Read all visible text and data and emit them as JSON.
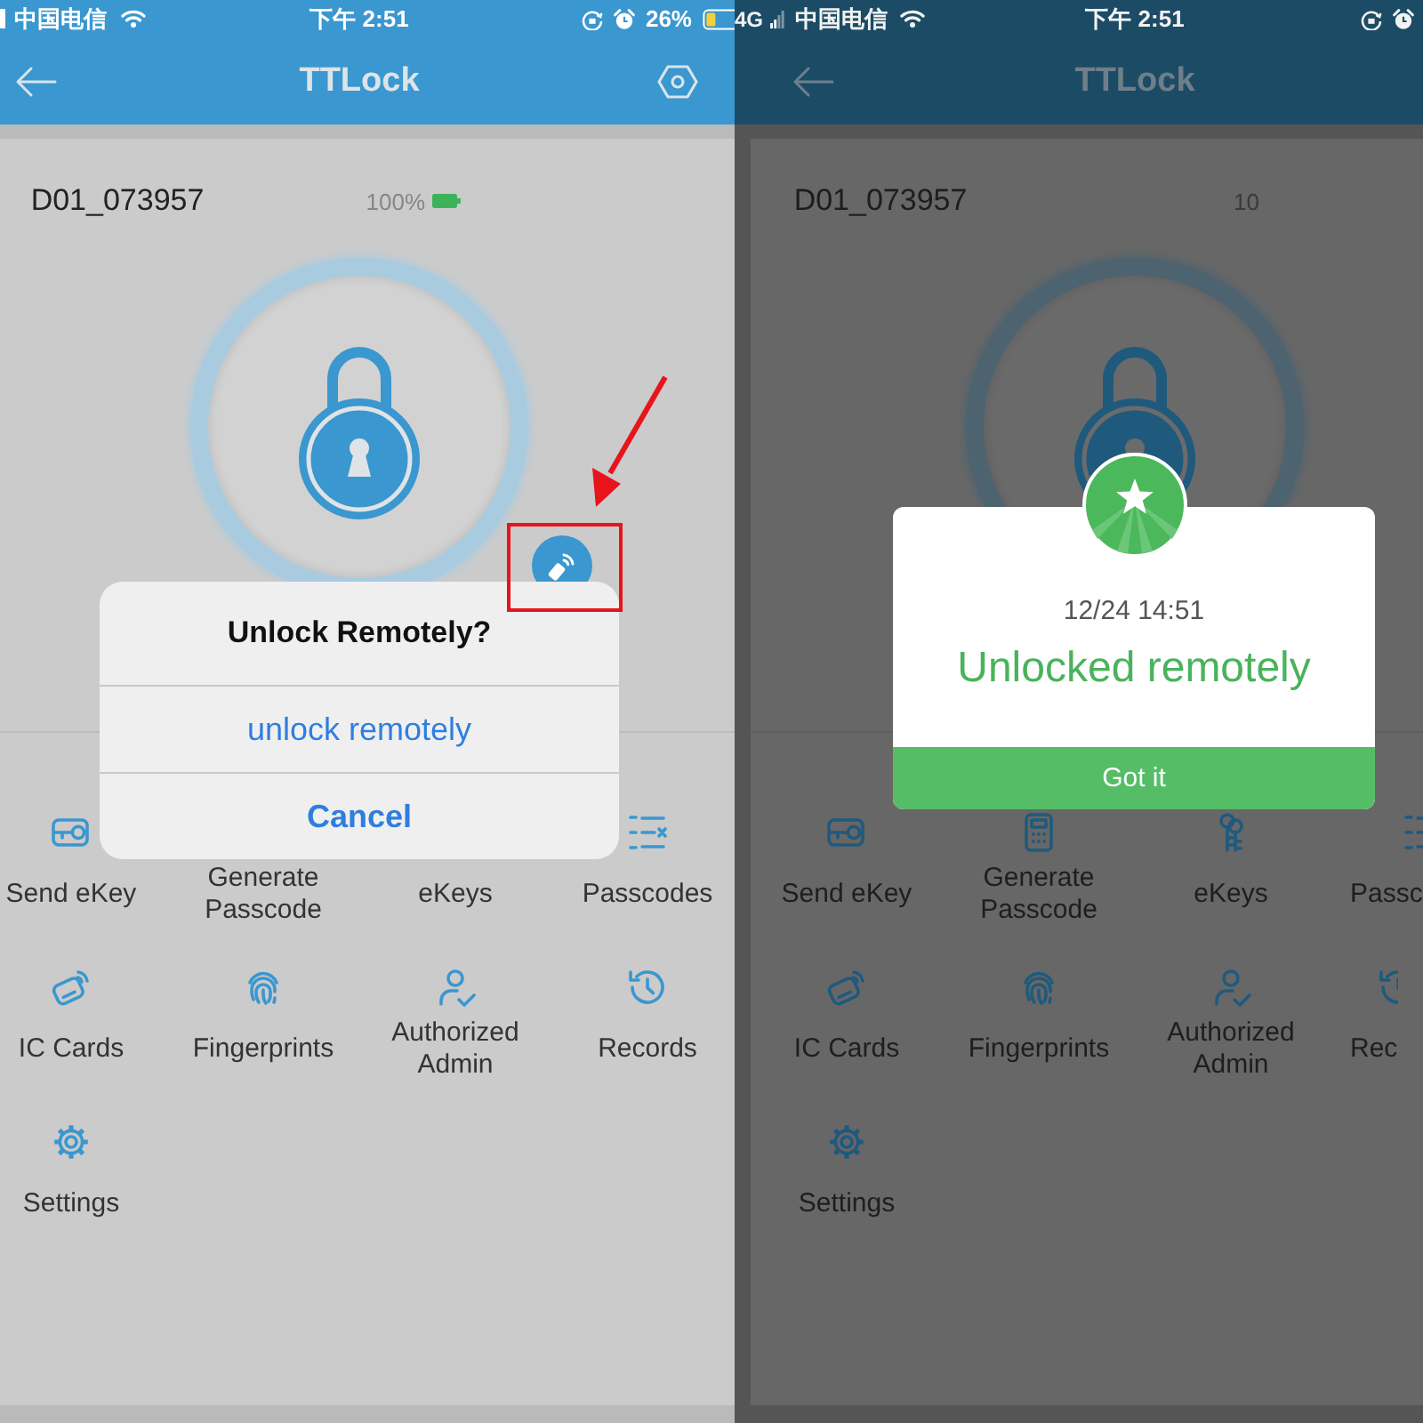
{
  "panels": [
    {
      "kind": "confirm",
      "status_bar": {
        "carrier": "中国电信",
        "time": "下午 2:51",
        "battery": "26%"
      },
      "nav": {
        "title": "TTLock"
      },
      "lock": {
        "name": "D01_073957",
        "battery": "100%"
      },
      "remote_button": {
        "highlighted": true
      },
      "dialog": {
        "title": "Unlock Remotely?",
        "actions": [
          {
            "label": "unlock remotely",
            "kind": "default"
          },
          {
            "label": "Cancel",
            "kind": "cancel"
          }
        ]
      },
      "menu": [
        "Send eKey",
        "Generate Passcode",
        "eKeys",
        "Passcodes",
        "IC Cards",
        "Fingerprints",
        "Authorized Admin",
        "Records",
        "Settings"
      ]
    },
    {
      "kind": "success",
      "status_bar": {
        "network": "4G",
        "carrier": "中国电信",
        "time": "下午 2:51"
      },
      "nav": {
        "title": "TTLock"
      },
      "lock": {
        "name": "D01_073957",
        "battery": "10"
      },
      "dialog": {
        "time": "12/24 14:51",
        "message": "Unlocked remotely",
        "button": "Got it"
      },
      "menu": [
        "Send eKey",
        "Generate Passcode",
        "eKeys",
        "Passc",
        "IC Cards",
        "Fingerprints",
        "Authorized Admin",
        "Rec",
        "Settings"
      ]
    }
  ]
}
